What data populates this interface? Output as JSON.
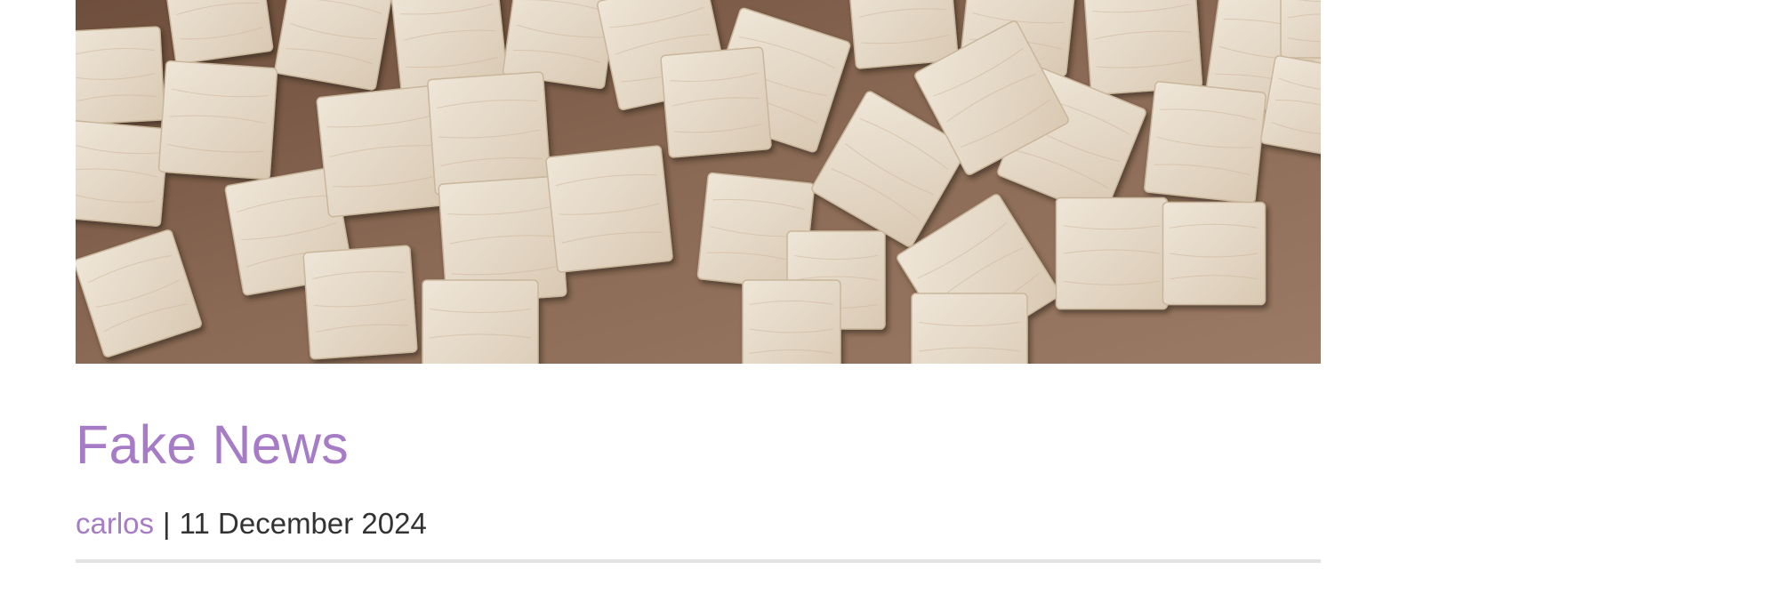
{
  "post": {
    "title": "Fake News",
    "author": "carlos",
    "separator": "|",
    "date": "11 December 2024",
    "image_alt": "wooden blocks scattered on a brown surface"
  },
  "colors": {
    "link_purple": "#a77cc6",
    "text_dark": "#333333",
    "divider_gray": "#e3e3e3",
    "image_background_brown": "#8a6a55",
    "block_wood": "#e6dac9"
  }
}
